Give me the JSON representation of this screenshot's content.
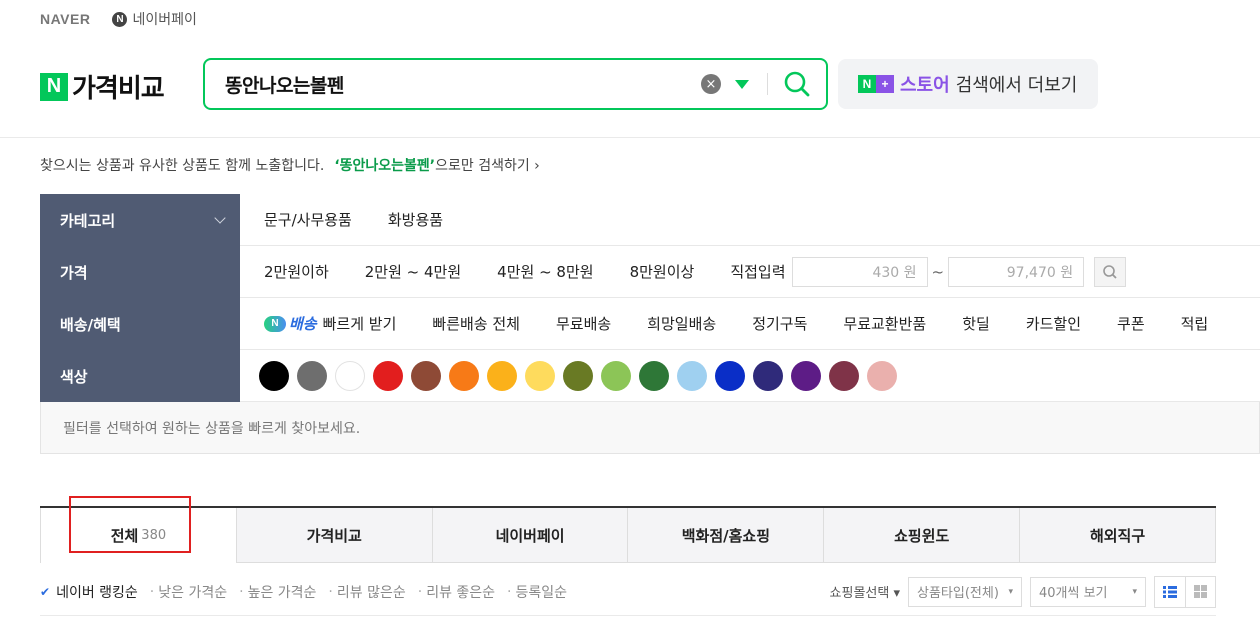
{
  "top_links": {
    "naver": "NAVER",
    "npay": "네이버페이",
    "npay_badge": "N"
  },
  "brand": {
    "badge": "N",
    "title": "가격비교"
  },
  "search": {
    "query": "똥안나오는볼펜"
  },
  "store_button": {
    "badge_n": "N",
    "badge_plus": "+",
    "store": "스토어",
    "suffix": "검색에서 더보기"
  },
  "notice": {
    "text": "찾으시는 상품과 유사한 상품도 함께 노출합니다.",
    "keyword": "‘똥안나오는볼펜’",
    "only_search": "으로만 검색하기 ›"
  },
  "filters": {
    "category": {
      "label": "카테고리",
      "items": [
        "문구/사무용품",
        "화방용품"
      ]
    },
    "price": {
      "label": "가격",
      "items": [
        "2만원이하",
        "2만원 ~ 4만원",
        "4만원 ~ 8만원",
        "8만원이상"
      ],
      "direct": "직접입력",
      "min": "430 원",
      "max": "97,470 원",
      "tilde": "~"
    },
    "delivery": {
      "label": "배송/혜택",
      "badge_n": "N",
      "badge_text": "배송",
      "items": [
        "빠르게 받기",
        "빠른배송 전체",
        "무료배송",
        "희망일배송",
        "정기구독",
        "무료교환반품",
        "핫딜",
        "카드할인",
        "쿠폰",
        "적립"
      ]
    },
    "color": {
      "label": "색상",
      "swatches": [
        "#000000",
        "#6e6e6e",
        "#ffffff",
        "#e21e1e",
        "#8e4a36",
        "#f77a17",
        "#fbb11a",
        "#fedb5d",
        "#697a24",
        "#8cc557",
        "#2e7737",
        "#9fd0f0",
        "#0a2ec7",
        "#2f2a7a",
        "#5d1c86",
        "#7f3348",
        "#eab0ad"
      ]
    },
    "hint": "필터를 선택하여 원하는 상품을 빠르게 찾아보세요."
  },
  "tabs": [
    {
      "label": "전체",
      "count": "380"
    },
    {
      "label": "가격비교"
    },
    {
      "label": "네이버페이"
    },
    {
      "label": "백화점/홈쇼핑"
    },
    {
      "label": "쇼핑윈도"
    },
    {
      "label": "해외직구"
    }
  ],
  "sort": {
    "options": [
      "네이버 랭킹순",
      "낮은 가격순",
      "높은 가격순",
      "리뷰 많은순",
      "리뷰 좋은순",
      "등록일순"
    ],
    "mall_select": "쇼핑몰선택 ▾",
    "product_type": "상품타입(전체)",
    "per_page": "40개씩 보기"
  }
}
